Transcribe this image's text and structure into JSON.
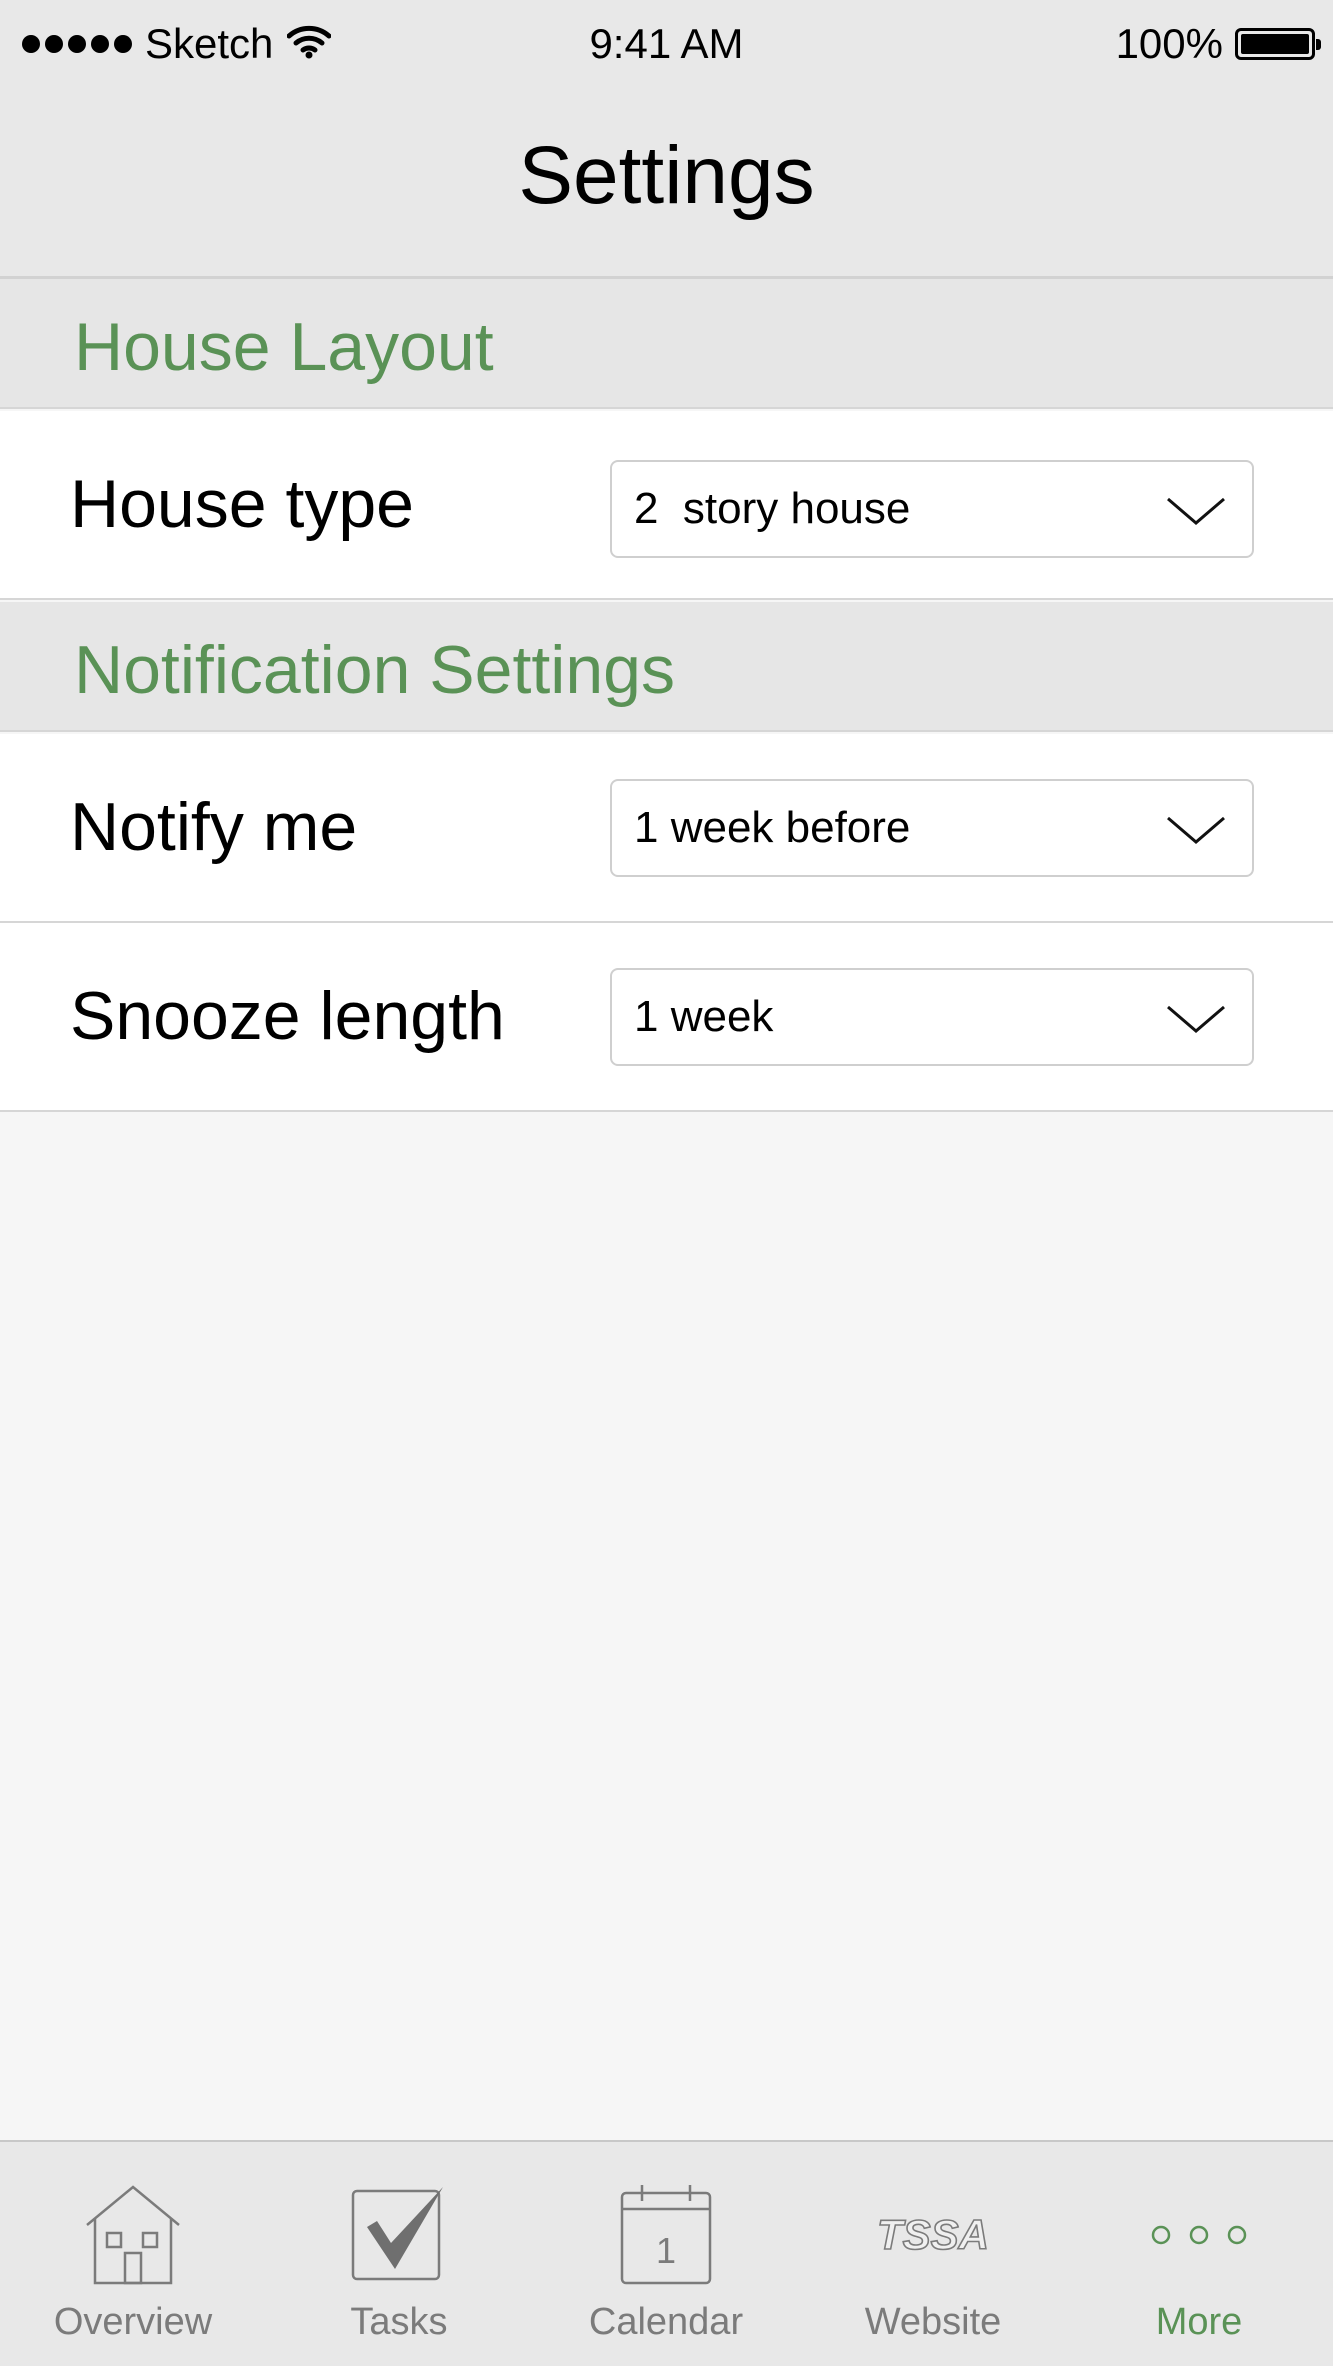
{
  "status_bar": {
    "carrier": "Sketch",
    "time": "9:41 AM",
    "battery": "100%"
  },
  "header": {
    "title": "Settings"
  },
  "colors": {
    "accent": "#5a9256",
    "tab_inactive": "#7b7b7b"
  },
  "sections": {
    "house_layout": {
      "title": "House Layout",
      "house_type": {
        "label": "House type",
        "value": "2  story house"
      }
    },
    "notifications": {
      "title": "Notification Settings",
      "notify_me": {
        "label": "Notify me",
        "value": "1 week before"
      },
      "snooze_length": {
        "label": "Snooze length",
        "value": "1 week"
      }
    }
  },
  "tab_bar": {
    "active": "More",
    "tabs": [
      {
        "label": "Overview",
        "icon": "house-icon"
      },
      {
        "label": "Tasks",
        "icon": "checkbox-icon"
      },
      {
        "label": "Calendar",
        "icon": "calendar-icon",
        "icon_text": "1"
      },
      {
        "label": "Website",
        "icon": "tssa-logo-icon",
        "icon_text": "TSSA"
      },
      {
        "label": "More",
        "icon": "more-dots-icon"
      }
    ]
  }
}
